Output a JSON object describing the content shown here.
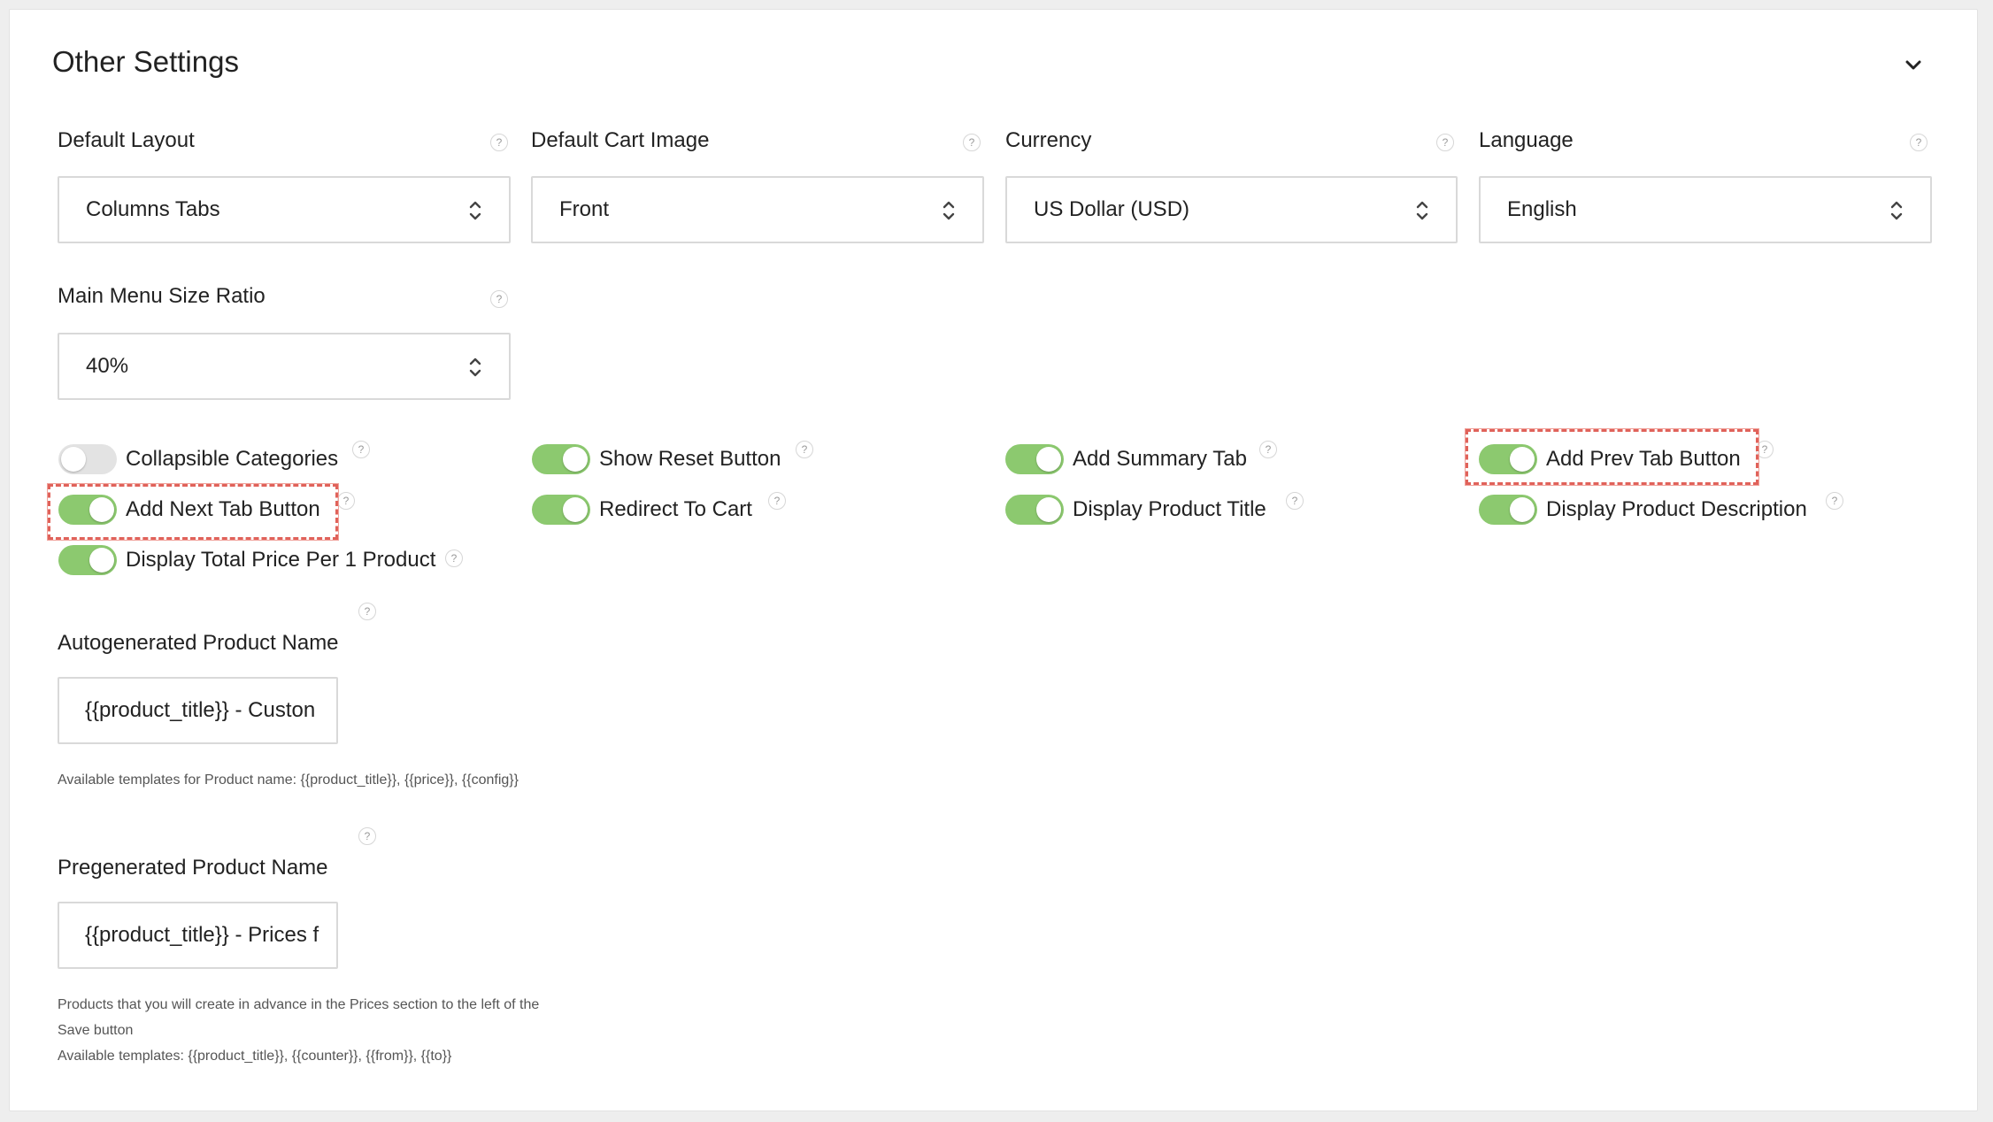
{
  "section": {
    "title": "Other Settings",
    "collapse_icon": "chevron-down-icon"
  },
  "help_glyph": "?",
  "colors": {
    "toggle_on": "#8cc96f",
    "toggle_off": "#e3e3e3",
    "highlight": "#e0625a"
  },
  "selects": {
    "default_layout": {
      "label": "Default Layout",
      "value": "Columns Tabs"
    },
    "default_cart_image": {
      "label": "Default Cart Image",
      "value": "Front"
    },
    "currency": {
      "label": "Currency",
      "value": "US Dollar (USD)"
    },
    "language": {
      "label": "Language",
      "value": "English"
    },
    "main_menu_size_ratio": {
      "label": "Main Menu Size Ratio",
      "value": "40%"
    }
  },
  "toggles": {
    "collapsible_categories": {
      "label": "Collapsible Categories",
      "on": false
    },
    "show_reset_button": {
      "label": "Show Reset Button",
      "on": true
    },
    "add_summary_tab": {
      "label": "Add Summary Tab",
      "on": true
    },
    "add_prev_tab_button": {
      "label": "Add Prev Tab Button",
      "on": true
    },
    "add_next_tab_button": {
      "label": "Add Next Tab Button",
      "on": true
    },
    "redirect_to_cart": {
      "label": "Redirect To Cart",
      "on": true
    },
    "display_product_title": {
      "label": "Display Product Title",
      "on": true
    },
    "display_product_description": {
      "label": "Display Product Description",
      "on": true
    },
    "display_total_price": {
      "label": "Display Total Price Per 1 Product",
      "on": true
    }
  },
  "autogenerated": {
    "label": "Autogenerated Product Name",
    "value": "{{product_title}} - Custon",
    "hint": "Available templates for Product name: {{product_title}}, {{price}}, {{config}}"
  },
  "pregenerated": {
    "label": "Pregenerated Product Name",
    "value": "{{product_title}} - Prices f",
    "hint_line1": "Products that you will create in advance in the Prices section to the left of the",
    "hint_line2": "Save button",
    "hint_line3": "Available templates: {{product_title}}, {{counter}}, {{from}}, {{to}}"
  }
}
